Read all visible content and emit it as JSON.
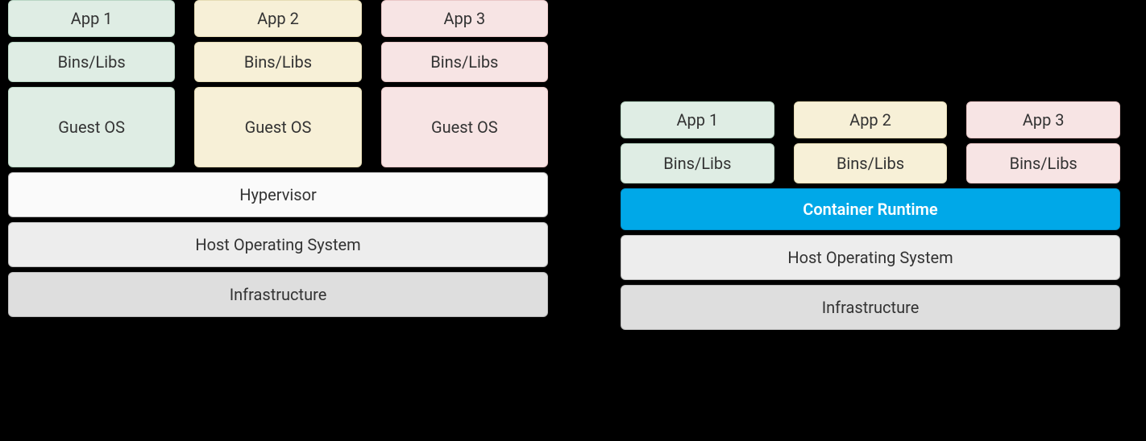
{
  "vm": {
    "columns": [
      {
        "app": "App 1",
        "bins": "Bins/Libs",
        "guest": "Guest OS"
      },
      {
        "app": "App 2",
        "bins": "Bins/Libs",
        "guest": "Guest OS"
      },
      {
        "app": "App 3",
        "bins": "Bins/Libs",
        "guest": "Guest OS"
      }
    ],
    "hypervisor": "Hypervisor",
    "host_os": "Host Operating System",
    "infrastructure": "Infrastructure"
  },
  "container": {
    "columns": [
      {
        "app": "App 1",
        "bins": "Bins/Libs"
      },
      {
        "app": "App 2",
        "bins": "Bins/Libs"
      },
      {
        "app": "App 3",
        "bins": "Bins/Libs"
      }
    ],
    "runtime": "Container Runtime",
    "host_os": "Host Operating System",
    "infrastructure": "Infrastructure"
  },
  "colors": {
    "green": "#dfede4",
    "yellow": "#f7f0d7",
    "pink": "#f7e4e4",
    "runtime": "#00a8e8"
  }
}
